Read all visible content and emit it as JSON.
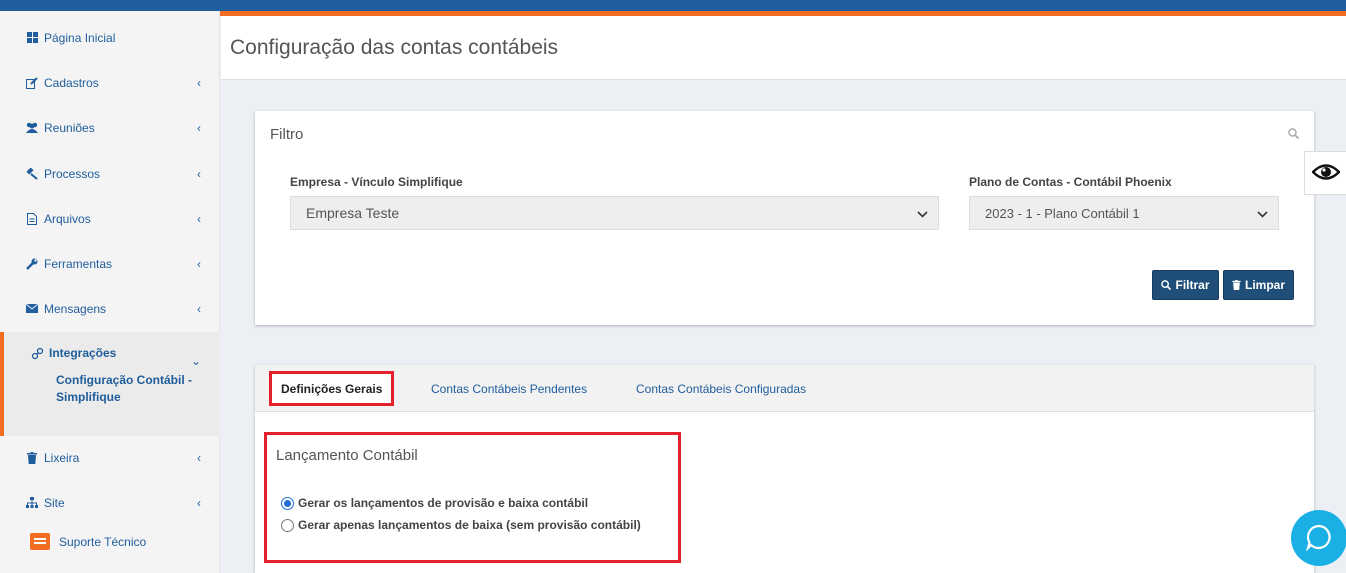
{
  "sidebar": {
    "items": [
      {
        "label": "Página Inicial",
        "icon": "dashboard-icon"
      },
      {
        "label": "Cadastros",
        "icon": "edit-icon"
      },
      {
        "label": "Reuniões",
        "icon": "users-icon"
      },
      {
        "label": "Processos",
        "icon": "gavel-icon"
      },
      {
        "label": "Arquivos",
        "icon": "file-icon"
      },
      {
        "label": "Ferramentas",
        "icon": "wrench-icon"
      },
      {
        "label": "Mensagens",
        "icon": "envelope-icon"
      },
      {
        "label": "Integrações",
        "icon": "link-icon"
      },
      {
        "label": "Lixeira",
        "icon": "trash-icon"
      },
      {
        "label": "Site",
        "icon": "sitemap-icon"
      }
    ],
    "sub_item": "Configuração Contábil - Simplifique",
    "suporte": "Suporte Técnico"
  },
  "header": {
    "title": "Configuração das contas contábeis"
  },
  "filter": {
    "title": "Filtro",
    "empresa_label": "Empresa - Vínculo Simplifique",
    "empresa_value": "Empresa Teste",
    "plano_label": "Plano de Contas - Contábil Phoenix",
    "plano_value": "2023 - 1 - Plano Contábil 1",
    "filtrar_label": "Filtrar",
    "limpar_label": "Limpar"
  },
  "tabs": [
    "Definições Gerais",
    "Contas Contábeis Pendentes",
    "Contas Contábeis Configuradas"
  ],
  "lancamento": {
    "title": "Lançamento Contábil",
    "option1": "Gerar os lançamentos de provisão e baixa contábil",
    "option2": "Gerar apenas lançamentos de baixa (sem provisão contábil)",
    "selected": 1
  },
  "colors": {
    "brand_blue": "#1f5d9c",
    "accent_orange": "#f26c21",
    "highlight_red": "#e3202c"
  }
}
